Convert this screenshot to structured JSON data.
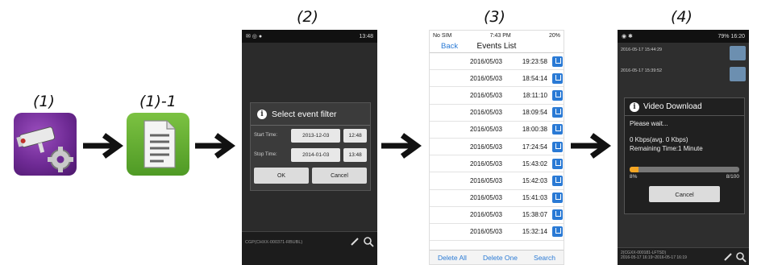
{
  "labels": {
    "s1": "(1)",
    "s1b": "(1)-1",
    "s2": "(2)",
    "s3": "(3)",
    "s4": "(4)"
  },
  "icons": {
    "app1": "cctv-gear-icon",
    "app2": "document-icon",
    "arrow": "arrow-right-icon"
  },
  "phone2": {
    "status_time": "13:48",
    "dialog_title": "Select event filter",
    "start_label": "Start Time:",
    "start_date": "2013-12-03",
    "start_time": "12:48",
    "stop_label": "Stop Time:",
    "stop_date": "2014-01-03",
    "stop_time": "13:48",
    "ok": "OK",
    "cancel": "Cancel",
    "footer": "CGP(CHXX-000371-RBUBL)"
  },
  "phone3": {
    "carrier": "No SIM",
    "time": "7:43 PM",
    "battery": "20%",
    "back": "Back",
    "title": "Events List",
    "events": [
      {
        "date": "2016/05/03",
        "time": "19:23:58"
      },
      {
        "date": "2016/05/03",
        "time": "18:54:14"
      },
      {
        "date": "2016/05/03",
        "time": "18:11:10"
      },
      {
        "date": "2016/05/03",
        "time": "18:09:54"
      },
      {
        "date": "2016/05/03",
        "time": "18:00:38"
      },
      {
        "date": "2016/05/03",
        "time": "17:24:54"
      },
      {
        "date": "2016/05/03",
        "time": "15:43:02"
      },
      {
        "date": "2016/05/03",
        "time": "15:42:03"
      },
      {
        "date": "2016/05/03",
        "time": "15:41:03"
      },
      {
        "date": "2016/05/03",
        "time": "15:38:07"
      },
      {
        "date": "2016/05/03",
        "time": "15:32:14"
      }
    ],
    "delete_all": "Delete All",
    "delete_one": "Delete One",
    "search": "Search"
  },
  "phone4": {
    "status_battery": "79%",
    "status_time": "16:20",
    "row1": "2016-05-17 15:44:29",
    "row2": "2016-05-17 15:39:52",
    "dialog_title": "Video Download",
    "wait": "Please wait...",
    "speed": "0 Kbps(avg. 0 Kbps)",
    "remaining": "Remaining Time:1 Minute",
    "progress_fraction": 0.08,
    "percent": "8%",
    "count": "8/100",
    "cancel": "Cancel",
    "footer1": "2(CGXX-000181-LFTSD)",
    "footer2": "2016-05-17 16:19~2016-05-17 16:19"
  },
  "colors": {
    "ios_blue": "#2a7ad5",
    "progress": "#f5a623"
  }
}
